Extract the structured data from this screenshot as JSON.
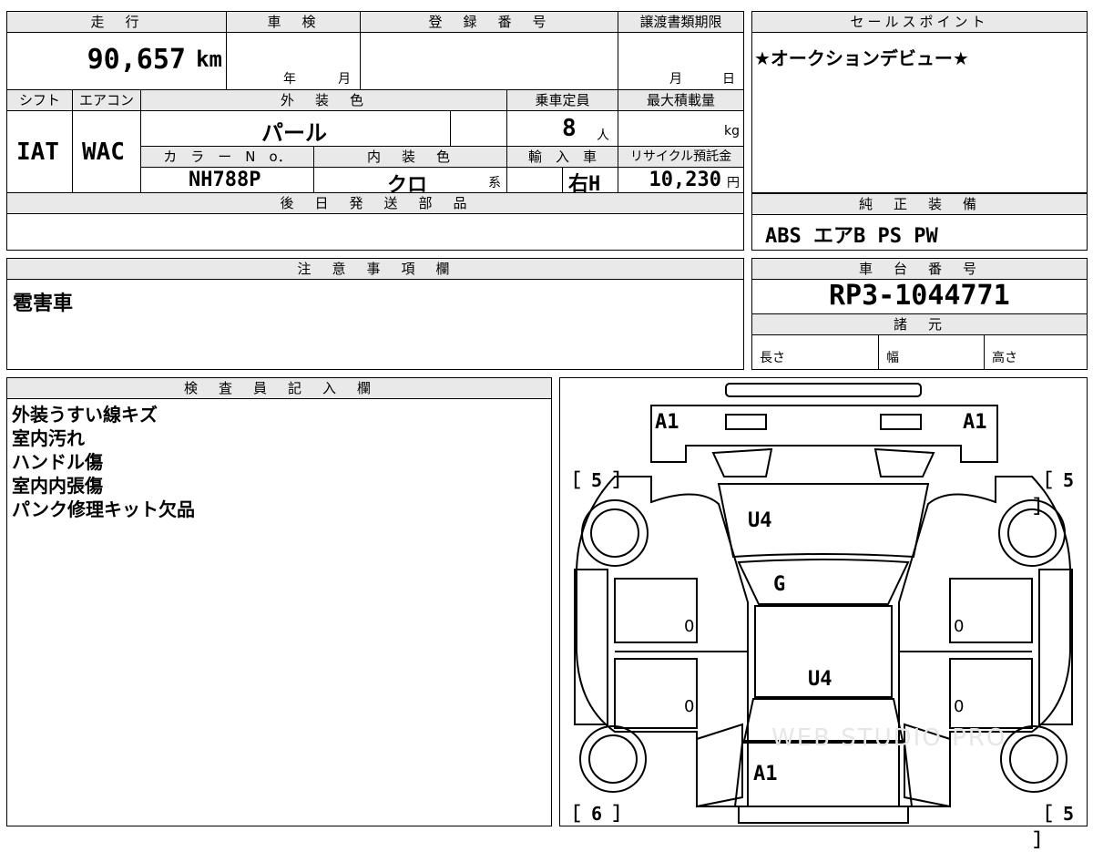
{
  "top": {
    "labels": {
      "mileage": "走　行",
      "inspection": "車　検",
      "registration": "登　録　番　号",
      "transfer_deadline": "譲渡書類期限"
    },
    "mileage_value": "90,657",
    "mileage_unit": "km",
    "inspection_year": "年",
    "inspection_month": "月",
    "transfer_month": "月",
    "transfer_day": "日"
  },
  "row2": {
    "labels": {
      "shift": "シフト",
      "aircon": "エアコン",
      "exterior_color": "外　装　色",
      "capacity": "乗車定員",
      "max_load": "最大積載量",
      "color_no": "カ　ラ　ー　N　o．",
      "interior_color": "内　装　色",
      "import": "輸　入　車",
      "recycle_fee": "リサイクル預託金"
    },
    "shift_value": "IAT",
    "aircon_value": "WAC",
    "exterior_color_value": "パール",
    "capacity_value": "8",
    "capacity_unit": "人",
    "max_load_unit": "kg",
    "color_no_value": "NH788P",
    "interior_color_value": "クロ",
    "interior_suffix": "系",
    "steering_value": "右H",
    "recycle_fee_value": "10,230",
    "recycle_fee_unit": "円"
  },
  "sales_point": {
    "label": "セールスポイント",
    "text": "★オークションデビュー★"
  },
  "later_parts": {
    "label": "後　日　発　送　部　品"
  },
  "genuine_equipment": {
    "label": "純　正　装　備",
    "text": "ABS エアB PS PW"
  },
  "notes": {
    "label": "注　意　事　項　欄",
    "text": "雹害車"
  },
  "chassis": {
    "label": "車　台　番　号",
    "value": "RP3-1044771",
    "spec_label": "諸　元",
    "length": "長さ",
    "width": "幅",
    "height": "高さ"
  },
  "inspector": {
    "label": "検　査　員　記　入　欄",
    "lines": [
      "外装うすい線キズ",
      "室内汚れ",
      "ハンドル傷",
      "室内内張傷",
      "パンク修理キット欠品"
    ]
  },
  "diagram": {
    "front_left": "A1",
    "front_right": "A1",
    "tire_fl": "［ 5 ］",
    "tire_fr": "［ 5 ］",
    "tire_rl": "［ 6 ］",
    "tire_rr": "［ 5 ］",
    "hood": "U4",
    "windshield": "G",
    "roof": "U4",
    "rear": "A1",
    "door_fl": "0",
    "door_rl": "0",
    "door_fr": "0",
    "door_rr": "0",
    "watermark": "WEB STUDIO PRO"
  }
}
